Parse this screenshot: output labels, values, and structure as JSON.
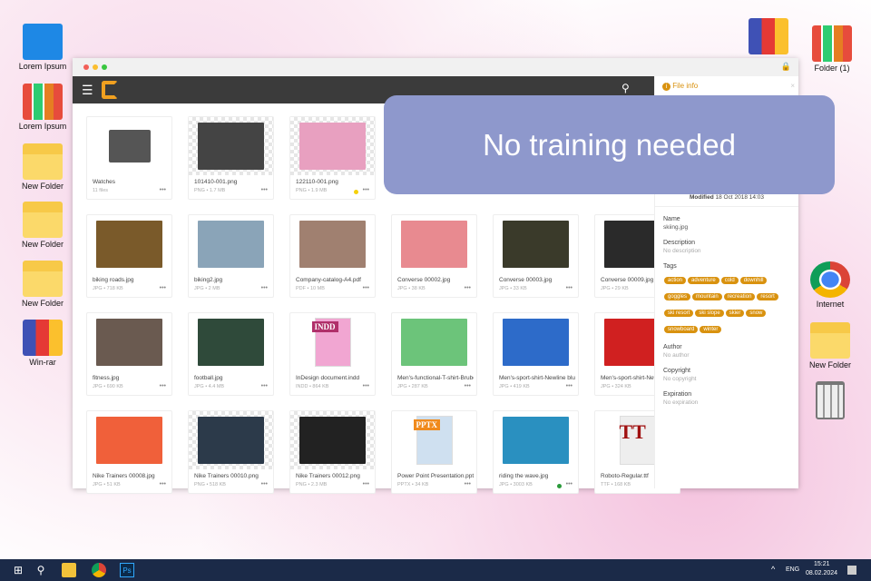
{
  "desktop": {
    "left": [
      "Lorem Ipsum",
      "Lorem Ipsum",
      "New Folder",
      "New Folder",
      "New Folder",
      "Win-rar"
    ],
    "right": [
      "Folder (1)",
      "Internet",
      "New Folder"
    ]
  },
  "files": [
    {
      "name": "Watches",
      "meta": "11 files",
      "kind": "folder"
    },
    {
      "name": "101410-001.png",
      "meta": "PNG • 1.7 MB",
      "kind": "chk",
      "color": "#444"
    },
    {
      "name": "122110-001.png",
      "meta": "PNG • 1.9 MB",
      "kind": "chk",
      "color": "#e8a0c0",
      "dot": "#f5d10c"
    },
    {
      "name": "",
      "meta": "",
      "kind": "hidden"
    },
    {
      "name": "",
      "meta": "",
      "kind": "hidden"
    },
    {
      "name": "",
      "meta": "",
      "kind": "hidden"
    },
    {
      "name": "biking roads.jpg",
      "meta": "JPG • 718 KB",
      "color": "#7a5a2a"
    },
    {
      "name": "biking2.jpg",
      "meta": "JPG • 2 MB",
      "color": "#8aa4b8"
    },
    {
      "name": "Company-catalog-A4.pdf",
      "meta": "PDF • 10 MB",
      "color": "#a08070"
    },
    {
      "name": "Converse 00002.jpg",
      "meta": "JPG • 38 KB",
      "color": "#e88a90"
    },
    {
      "name": "Converse 00003.jpg",
      "meta": "JPG • 33 KB",
      "color": "#3a3a2a"
    },
    {
      "name": "Converse 00009.jpg",
      "meta": "JPG • 29 KB",
      "color": "#2a2a2a"
    },
    {
      "name": "fitness.jpg",
      "meta": "JPG • 690 KB",
      "color": "#6a5a50"
    },
    {
      "name": "football.jpg",
      "meta": "JPG • 4.4 MB",
      "color": "#2f4a3a"
    },
    {
      "name": "InDesign document.indd",
      "meta": "INDD • 864 KB",
      "color": "#f1a6d2",
      "badge": "INDD"
    },
    {
      "name": "Men's-functional-T-shirt-Brubeck",
      "meta": "JPG • 287 KB",
      "color": "#6cc47a"
    },
    {
      "name": "Men's-sport-shirt-Newline blue",
      "meta": "JPG • 419 KB",
      "color": "#2d6bc9"
    },
    {
      "name": "Men's-sport-shirt-Newline red",
      "meta": "JPG • 324 KB",
      "color": "#d02020"
    },
    {
      "name": "Nike Trainers 00008.jpg",
      "meta": "JPG • 51 KB",
      "color": "#f0603a"
    },
    {
      "name": "Nike Trainers 00010.png",
      "meta": "PNG • 518 KB",
      "kind": "chk",
      "color": "#2c3a4a"
    },
    {
      "name": "Nike Trainers 00012.png",
      "meta": "PNG • 2.3 MB",
      "kind": "chk",
      "color": "#222"
    },
    {
      "name": "Power Point Presentation.pptx",
      "meta": "PPTX • 34 KB",
      "color": "#cfe0f0",
      "badge": "PPTX"
    },
    {
      "name": "riding the wave.jpg",
      "meta": "JPG • 3003 KB",
      "color": "#2a90c0",
      "dot": "#2a9a3a"
    },
    {
      "name": "Roboto-Regular.ttf",
      "meta": "TTF • 168 KB",
      "color": "#eee",
      "badge": "TT"
    }
  ],
  "panel": {
    "title": "File info",
    "modified_label": "Modified",
    "modified": "18 Oct 2018 14:03",
    "name_label": "Name",
    "name": "skiing.jpg",
    "desc_label": "Description",
    "desc": "No description",
    "tags_label": "Tags",
    "tags": [
      "action",
      "adventure",
      "cold",
      "downhill",
      "goggles",
      "mountain",
      "recreation",
      "resort",
      "ski resort",
      "ski slope",
      "skier",
      "snow",
      "snowboard",
      "winter"
    ],
    "author_label": "Author",
    "author": "No author",
    "copyright_label": "Copyright",
    "copyright": "No copyright",
    "exp_label": "Expiration",
    "exp": "No expiration"
  },
  "banner": "No training needed",
  "taskbar": {
    "lang": "ENG",
    "time": "15:21",
    "date": "08.02.2024"
  },
  "colors": {
    "accent": "#d9920f",
    "toolbar": "#3b3b3b",
    "banner": "#8e98cc"
  }
}
